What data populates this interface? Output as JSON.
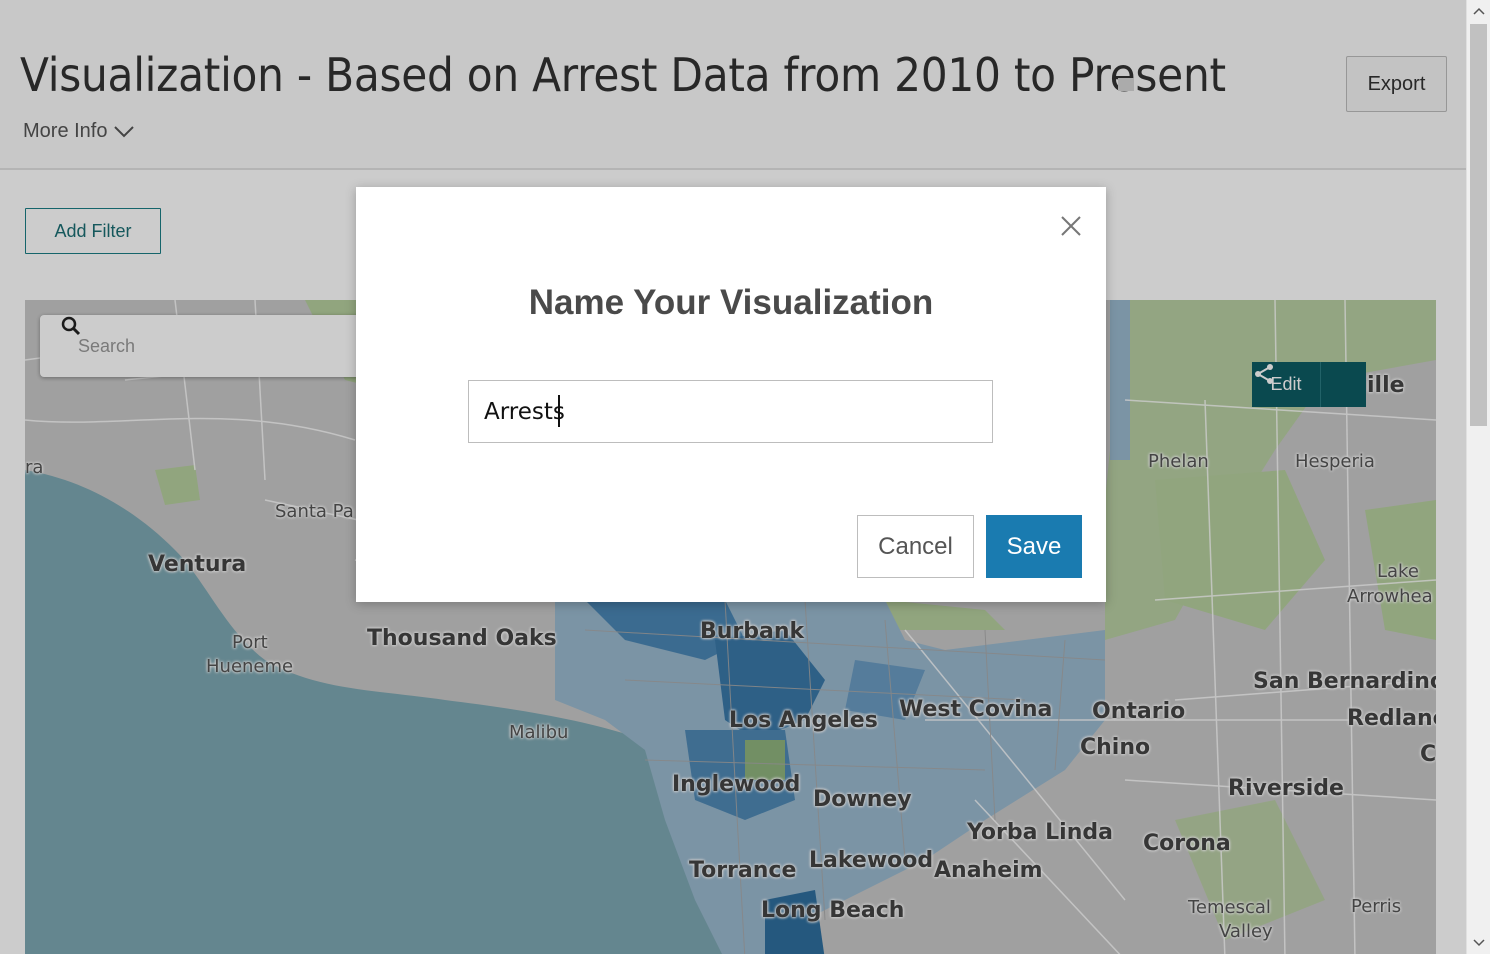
{
  "header": {
    "title": "Visualization - Based on Arrest Data from 2010 to Present",
    "more_info": "More Info",
    "export_label": "Export"
  },
  "toolbar": {
    "add_filter_label": "Add Filter"
  },
  "map": {
    "search_placeholder": "Search",
    "edit_label": "Edit",
    "labels": {
      "ventura": "Ventura",
      "santa_paula": "Santa Pa",
      "ra": "ra",
      "port_hueneme_1": "Port",
      "port_hueneme_2": "Hueneme",
      "thousand_oaks": "Thousand Oaks",
      "malibu": "Malibu",
      "burbank": "Burbank",
      "los_angeles": "Los Angeles",
      "inglewood": "Inglewood",
      "downey": "Downey",
      "torrance": "Torrance",
      "lakewood": "Lakewood",
      "long_beach": "Long Beach",
      "west_covina": "West Covina",
      "ontario": "Ontario",
      "chino": "Chino",
      "yorba_linda": "Yorba Linda",
      "anaheim": "Anaheim",
      "corona": "Corona",
      "riverside": "Riverside",
      "san_bernardino": "San Bernardino",
      "redlands": "Redlanc",
      "c": "C",
      "phelan": "Phelan",
      "hesperia": "Hesperia",
      "victorville": "ille",
      "lake_arrowhead_1": "Lake",
      "lake_arrowhead_2": "Arrowhea",
      "temescal_1": "Temescal",
      "temescal_2": "Valley",
      "perris": "Perris"
    },
    "colors": {
      "ocean": "#7ea8b3",
      "land": "#c9c9c9",
      "park": "#b6cf9e",
      "choropleth_dark": "#2f6f9e",
      "choropleth_light": "#9ab9cf"
    }
  },
  "modal": {
    "title": "Name Your Visualization",
    "input_value": "Arrests",
    "cancel_label": "Cancel",
    "save_label": "Save"
  },
  "icons": {
    "search": "search-icon",
    "share": "share-icon",
    "close": "close-icon",
    "chevron": "chevron-down-icon"
  }
}
